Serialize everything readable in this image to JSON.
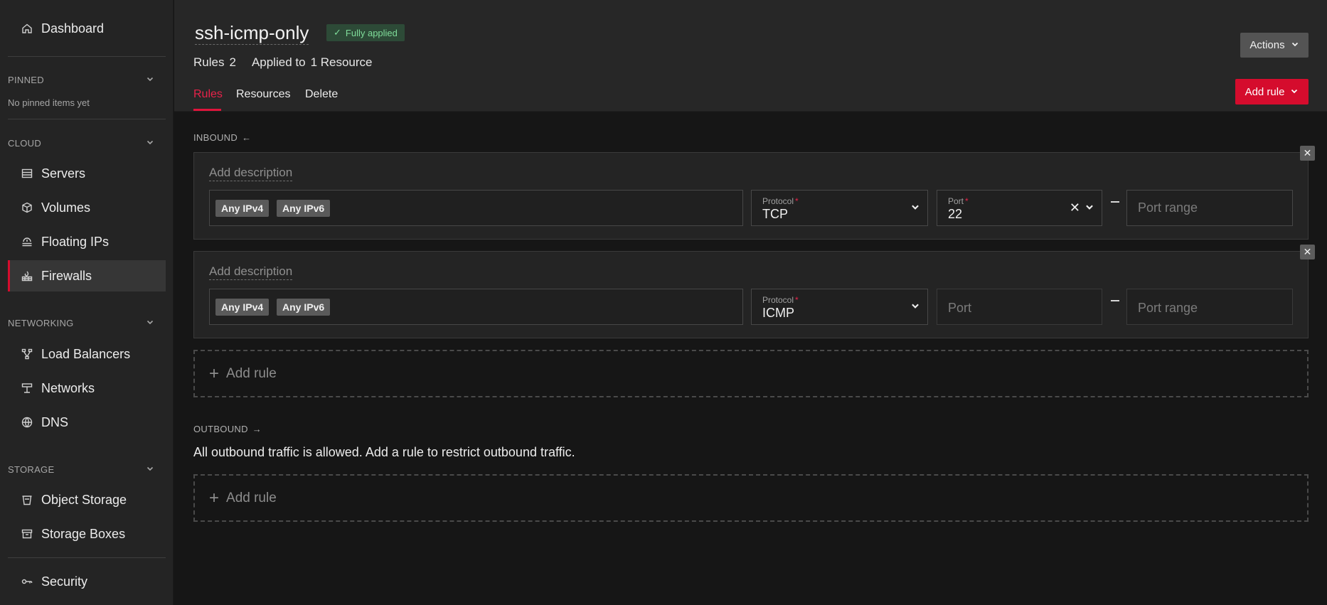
{
  "sidebar": {
    "dashboard": "Dashboard",
    "pinned": {
      "title": "PINNED",
      "empty": "No pinned items yet"
    },
    "cloud": {
      "title": "CLOUD",
      "items": [
        "Servers",
        "Volumes",
        "Floating IPs",
        "Firewalls"
      ]
    },
    "networking": {
      "title": "NETWORKING",
      "items": [
        "Load Balancers",
        "Networks",
        "DNS"
      ]
    },
    "storage": {
      "title": "STORAGE",
      "items": [
        "Object Storage",
        "Storage Boxes"
      ]
    },
    "security": "Security",
    "active_item": "Firewalls"
  },
  "header": {
    "title": "ssh-icmp-only",
    "status": "Fully applied",
    "rules_label": "Rules",
    "rules_count": "2",
    "applied_label": "Applied to",
    "applied_value": "1 Resource",
    "tabs": [
      "Rules",
      "Resources",
      "Delete"
    ],
    "actions_label": "Actions",
    "add_rule_label": "Add rule"
  },
  "inbound": {
    "label": "INBOUND",
    "rules": [
      {
        "description_placeholder": "Add description",
        "sources": [
          "Any IPv4",
          "Any IPv6"
        ],
        "protocol_label": "Protocol",
        "protocol": "TCP",
        "port_label": "Port",
        "port": "22",
        "port_range_placeholder": "Port range"
      },
      {
        "description_placeholder": "Add description",
        "sources": [
          "Any IPv4",
          "Any IPv6"
        ],
        "protocol_label": "Protocol",
        "protocol": "ICMP",
        "port_placeholder": "Port",
        "port_range_placeholder": "Port range"
      }
    ],
    "add_rule": "Add rule"
  },
  "outbound": {
    "label": "OUTBOUND",
    "message": "All outbound traffic is allowed. Add a rule to restrict outbound traffic.",
    "add_rule": "Add rule"
  },
  "colors": {
    "accent": "#d50c2d",
    "success": "#7fdc9a"
  }
}
